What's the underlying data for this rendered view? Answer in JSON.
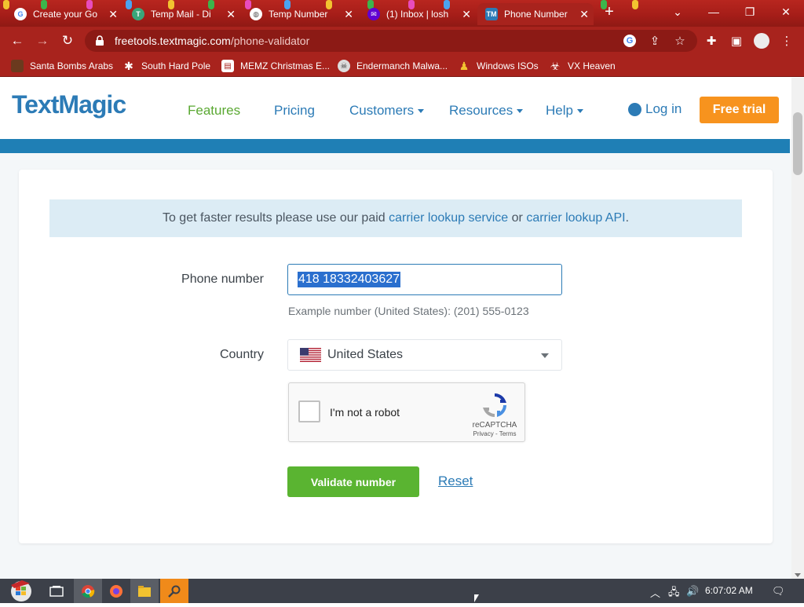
{
  "browser": {
    "tabs": [
      {
        "title": "Create your Go",
        "favicon": "google-icon"
      },
      {
        "title": "Temp Mail - Di",
        "favicon": "tempmail-icon"
      },
      {
        "title": "Temp Number",
        "favicon": "globe-icon"
      },
      {
        "title": "(1) Inbox | losh",
        "favicon": "yahoo-mail-icon"
      },
      {
        "title": "Phone Number",
        "favicon": "textmagic-icon",
        "active": true
      }
    ],
    "new_tab_label": "+",
    "url_host": "freetools.textmagic.com",
    "url_path": "/phone-validator",
    "bookmarks": [
      {
        "label": "Santa Bombs Arabs",
        "icon": "person-icon"
      },
      {
        "label": "South Hard Pole",
        "icon": "snowflake-icon"
      },
      {
        "label": "MEMZ Christmas E...",
        "icon": "window-icon"
      },
      {
        "label": "Endermanch Malwa...",
        "icon": "skull-icon"
      },
      {
        "label": "Windows ISOs",
        "icon": "pawn-icon"
      },
      {
        "label": "VX Heaven",
        "icon": "biohazard-icon"
      }
    ]
  },
  "site": {
    "logo": "TextMagic",
    "nav": {
      "features": "Features",
      "pricing": "Pricing",
      "customers": "Customers",
      "resources": "Resources",
      "help": "Help"
    },
    "login": "Log in",
    "free_trial": "Free trial"
  },
  "form": {
    "notice_prefix": "To get faster results please use our paid ",
    "notice_link1": "carrier lookup service",
    "notice_mid": " or ",
    "notice_link2": "carrier lookup API",
    "notice_suffix": ".",
    "phone_label": "Phone number",
    "phone_value": "418 18332403627",
    "example": "Example number (United States): (201) 555-0123",
    "country_label": "Country",
    "country_value": "United States",
    "captcha_label": "I'm not a robot",
    "captcha_brand": "reCAPTCHA",
    "captcha_links": "Privacy - Terms",
    "validate_button": "Validate number",
    "reset_link": "Reset"
  },
  "taskbar": {
    "clock": "6:07:02 AM"
  },
  "colors": {
    "brand_blue": "#2c7bb6",
    "brand_green": "#5ab431",
    "cta_orange": "#f7931e",
    "browser_red": "#a8231d"
  }
}
